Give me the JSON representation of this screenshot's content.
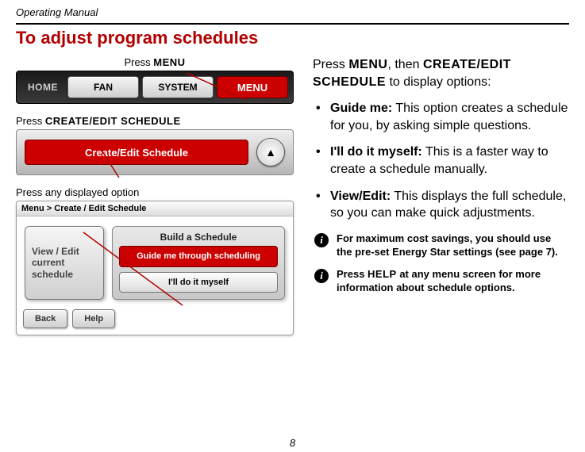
{
  "doc_header": "Operating Manual",
  "title": "To adjust program schedules",
  "page_number": "8",
  "left": {
    "caption1_prefix": "Press ",
    "caption1_bold": "MENU",
    "panel1": {
      "home": "HOME",
      "fan": "FAN",
      "system": "SYSTEM",
      "menu": "MENU"
    },
    "caption2_prefix": "Press ",
    "caption2_bold": "CREATE/EDIT SCHEDULE",
    "panel2": {
      "button": "Create/Edit Schedule",
      "arrow": "▲"
    },
    "caption3": "Press any displayed option",
    "panel3": {
      "breadcrumb": "Menu > Create / Edit Schedule",
      "side": "View / Edit current schedule",
      "group_title": "Build a Schedule",
      "guide": "Guide me through scheduling",
      "myself": "I'll do it myself",
      "back": "Back",
      "help": "Help"
    }
  },
  "right": {
    "intro_1": "Press ",
    "intro_menu": "MENU",
    "intro_2": ", then ",
    "intro_ces": "CREATE/EDIT SCHEDULE",
    "intro_3": " to display options:",
    "opt1_name": "Guide me:",
    "opt1_text": " This option creates a schedule for you, by asking simple questions.",
    "opt2_name": "I'll do it myself:",
    "opt2_text": " This is a faster way to create a schedule manually.",
    "opt3_name": "View/Edit:",
    "opt3_text": " This displays the full schedule, so you can make quick adjustments.",
    "note1": "For maximum cost savings, you should use the pre-set Energy Star settings (see page 7).",
    "note2_1": "Press ",
    "note2_help": "HELP",
    "note2_2": " at any menu screen for more information about schedule options."
  }
}
